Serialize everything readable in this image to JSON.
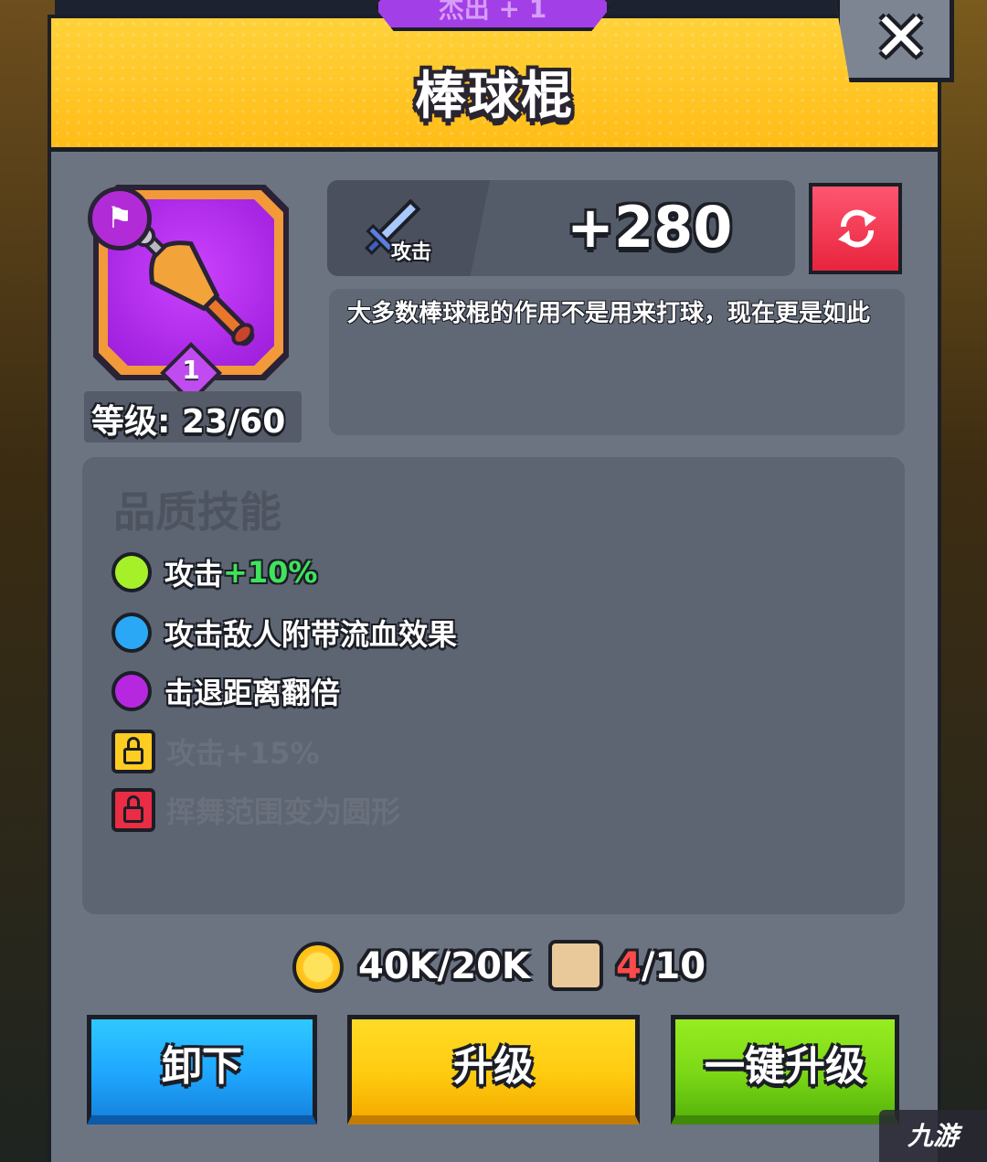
{
  "rarity_tag": "杰出 + 1",
  "item": {
    "name": "棒球棍",
    "star": "1",
    "level_text": "等级: 23/60"
  },
  "stat": {
    "label": "攻击",
    "value": "+280"
  },
  "description": "大多数棒球棍的作用不是用来打球，现在更是如此",
  "skills": {
    "title": "品质技能",
    "items": [
      {
        "text": "攻击",
        "bonus": "+10%",
        "color": "#a6f02a",
        "locked": false
      },
      {
        "text": "攻击敌人附带流血效果",
        "bonus": "",
        "color": "#2aa8f5",
        "locked": false
      },
      {
        "text": "击退距离翻倍",
        "bonus": "",
        "color": "#b628e0",
        "locked": false
      },
      {
        "text": "攻击+15%",
        "bonus": "",
        "color": "#ffcc22",
        "locked": true
      },
      {
        "text": "挥舞范围变为圆形",
        "bonus": "",
        "color": "#ea2c44",
        "locked": true
      }
    ]
  },
  "costs": {
    "coins": "40K/20K",
    "scroll_current": "4",
    "scroll_max": "/10"
  },
  "buttons": {
    "unequip": "卸下",
    "upgrade": "升级",
    "upgrade_all": "一键升级"
  },
  "logo": "九游",
  "colors": {
    "header": "#ffc81f",
    "panel": "#6c7482",
    "btn_blue": "#1fa8ff",
    "btn_yellow": "#ffcc11",
    "btn_green": "#7cd916",
    "refresh": "#f03550"
  }
}
